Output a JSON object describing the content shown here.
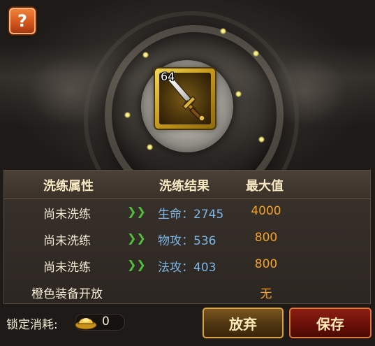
{
  "help_button": {
    "label": "?"
  },
  "item": {
    "level": "64",
    "icon": "dagger-icon",
    "quality_color": "#d4a52a"
  },
  "attributes": {
    "headers": {
      "attribute": "洗练属性",
      "result": "洗练结果",
      "max": "最大值"
    },
    "rows": [
      {
        "status": "尚未洗练",
        "result": "生命：2745",
        "max": "4000"
      },
      {
        "status": "尚未洗练",
        "result": "物攻：536",
        "max": "800"
      },
      {
        "status": "尚未洗练",
        "result": "法攻：403",
        "max": "800"
      },
      {
        "status": "橙色装备开放",
        "result": "",
        "max": "无"
      }
    ]
  },
  "lock_cost": {
    "label": "锁定消耗:",
    "value": "0",
    "icon": "gold-ingot-icon"
  },
  "buttons": {
    "abandon": "放弃",
    "save": "保存"
  },
  "colors": {
    "result_text": "#7bb6e6",
    "max_text": "#f3a224",
    "arrow": "#4fbf3d",
    "save_button": "#6a1008",
    "abandon_button": "#4e3510"
  }
}
